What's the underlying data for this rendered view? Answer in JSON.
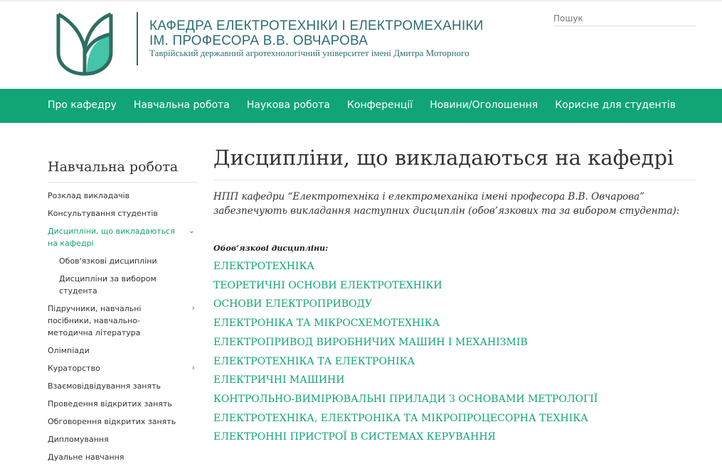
{
  "header": {
    "title_line1": "КАФЕДРА ЕЛЕКТРОТЕХНІКИ І ЕЛЕКТРОМЕХАНІКИ",
    "title_line2": "ІМ. ПРОФЕСОРА В.В. ОВЧАРОВА",
    "subtitle": "Таврійський державний агротехнологічний університет імені Дмитра Моторного",
    "search_placeholder": "Пошук"
  },
  "colors": {
    "brand": "#11a476",
    "logo_dark": "#2e6e62",
    "logo_fill": "#44c4a8"
  },
  "nav": [
    "Про кафедру",
    "Навчальна робота",
    "Наукова робота",
    "Конференції",
    "Новини/Оголошення",
    "Корисне для студентів"
  ],
  "sidebar": {
    "title": "Навчальна робота",
    "items": [
      {
        "label": "Розклад викладачів"
      },
      {
        "label": "Консультування студентів"
      },
      {
        "label": "Дисципліни, що викладаються на кафедрі",
        "active": true,
        "chevron": "⌄"
      },
      {
        "label": "Обов'язкові дисципліни",
        "sub": true
      },
      {
        "label": "Дисципліни за вибором студента",
        "sub": true
      },
      {
        "label": "Підручники, навчальні посібники, навчально-методична література",
        "chevron": "›"
      },
      {
        "label": "Олімпіади"
      },
      {
        "label": "Кураторство",
        "chevron": "›"
      },
      {
        "label": "Взаємовідвідування занять"
      },
      {
        "label": "Проведення відкритих занять"
      },
      {
        "label": "Обговорення відкритих занять"
      },
      {
        "label": "Дипломування"
      },
      {
        "label": "Дуальне навчання"
      }
    ]
  },
  "main": {
    "title": "Дисципліни, що викладаються на кафедрі",
    "intro": "НПП кафедри “Електротехніка і електромеханіка імені професора В.В. Овчарова” забезпечують викладання наступних дисциплін (обов’язкових та за вибором студента):",
    "required_heading": "Обов’язкові дисципліни:",
    "disciplines": [
      "ЕЛЕКТРОТЕХНІКА",
      "ТЕОРЕТИЧНІ ОСНОВИ ЕЛЕКТРОТЕХНІКИ",
      "ОСНОВИ ЕЛЕКТРОПРИВОДУ",
      "ЕЛЕКТРОНІКА ТА МІКРОСХЕМОТЕХНІКА",
      "ЕЛЕКТРОПРИВОД ВИРОБНИЧИХ МАШИН І МЕХАНІЗМІВ",
      "ЕЛЕКТРОТЕХНІКА ТА ЕЛЕКТРОНІКА",
      "ЕЛЕКТРИЧНІ МАШИНИ",
      "КОНТРОЛЬНО-ВИМІРЮВАЛЬНІ ПРИЛАДИ З ОСНОВАМИ МЕТРОЛОГІЇ",
      "ЕЛЕКТРОТЕХНІКА, ЕЛЕКТРОНІКА ТА МІКРОПРОЦЕСОРНА ТЕХНІКА",
      "ЕЛЕКТРОННІ ПРИСТРОЇ В СИСТЕМАХ КЕРУВАННЯ"
    ]
  }
}
